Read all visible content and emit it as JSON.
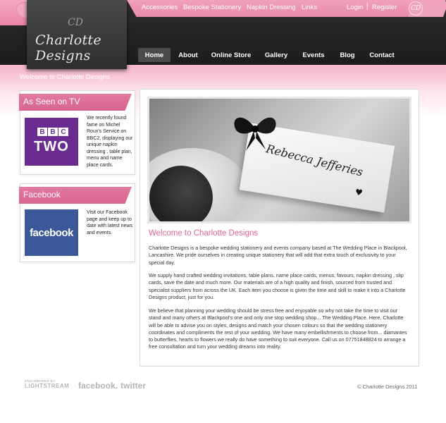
{
  "header": {
    "logo": "Charlotte Designs",
    "logo_mark": "CD",
    "top_links": [
      "Accessories",
      "Bespoke Stationery",
      "Napkin Dressing",
      "Links"
    ],
    "account_links": [
      "Login",
      "Register"
    ],
    "nav": [
      "Home",
      "About",
      "Online Store",
      "Gallery",
      "Events",
      "Blog",
      "Contact"
    ],
    "active_nav": "Home"
  },
  "welcome_bar": "Welcome to Charlotte Designs",
  "sidebar": {
    "tv": {
      "title": "As Seen on TV",
      "logo_top": [
        "B",
        "B",
        "C"
      ],
      "logo_bottom": "TWO",
      "text": "We recently found fame on Michel Roux's Service on BBC2, displaying our unique napkin dressing , table plan, menu and name place cards."
    },
    "facebook": {
      "title": "Facebook",
      "logo": "facebook",
      "text": "Visit our Facebook page and keep up to date with latest news and events."
    }
  },
  "main": {
    "photo_name": "Rebecca Jefferies",
    "title": "Welcome to Charlotte Designs",
    "paragraphs": [
      "Charlotte Designs is a bespoke wedding stationery and events company based at The Wedding Place in Blackpool, Lancashire. We pride ourselves in creating unique stationery that will add that extra touch of exclusivity to your special day.",
      "We supply hand crafted wedding invitations, table plans, name place cards, menus, favours, napkin dressing , slip cards, save the date and much more. Our materials are of a high quality and finish, sourced from trusted and specialist suppliers from across the UK. Each item you choose is given the time and skill to make it into a Charlotte Designs product, just for you.",
      "We believe that planning your wedding should be stress free and enjoyable so why not take the time to visit our stand and many others at Blackpool's one and only one stop wedding shop... The Wedding Place. Here, Charlotte will be able to advise you on styles, designs and match your chosen colours so that the wedding stationery coordinates and compliments the rest of your wedding. We have many embellishments to choose from... diamantes to butterflies, hearts to flowers we really do have something to suit everyone. Call us on 07751848824 to arrange a free consultation and turn your wedding dreams into reality."
    ]
  },
  "footer": {
    "powered_by": "ENGINEERED BY",
    "brand1": "LIGHTSTREAM",
    "brand2": "facebook.",
    "brand3": "twitter",
    "copyright": "© Charlotte Designs 2011"
  }
}
